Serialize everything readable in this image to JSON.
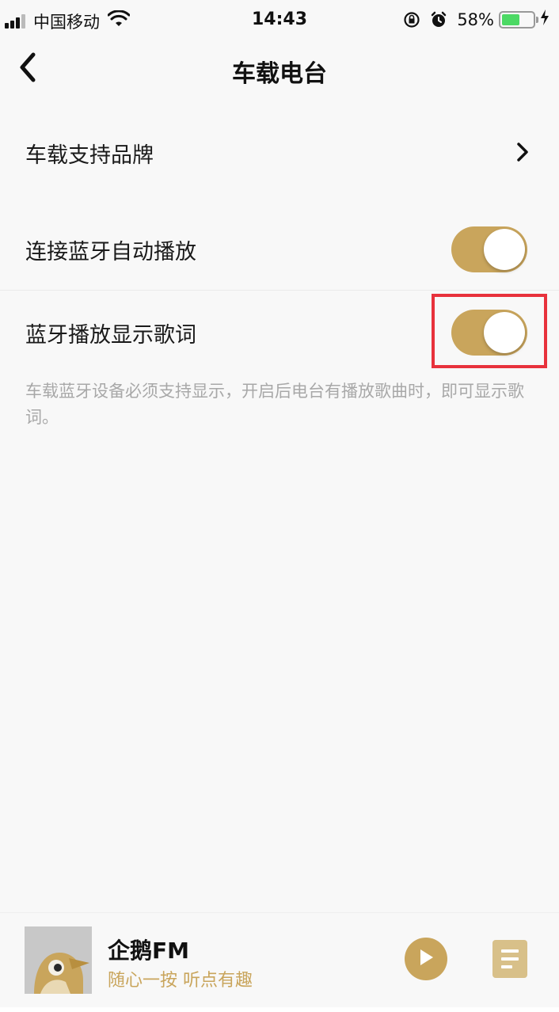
{
  "status_bar": {
    "carrier": "中国移动",
    "time": "14:43",
    "battery": "58%",
    "battery_level": 0.58,
    "icons": [
      "signal-icon",
      "wifi-icon",
      "rotation-lock-icon",
      "alarm-icon",
      "battery-icon",
      "charging-icon"
    ]
  },
  "nav": {
    "title": "车载电台"
  },
  "settings": {
    "brand_row": {
      "label": "车载支持品牌"
    },
    "auto_play_row": {
      "label": "连接蓝牙自动播放",
      "enabled": true
    },
    "lyrics_row": {
      "label": "蓝牙播放显示歌词",
      "enabled": true
    },
    "hint": "车载蓝牙设备必须支持显示，开启后电台有播放歌曲时，即可显示歌词。"
  },
  "player": {
    "title": "企鹅FM",
    "subtitle": "随心一按 听点有趣"
  },
  "colors": {
    "accent": "#c9a55c",
    "highlight": "#e8323c",
    "hint_text": "#a8a8a8",
    "background": "#f8f8f8"
  }
}
